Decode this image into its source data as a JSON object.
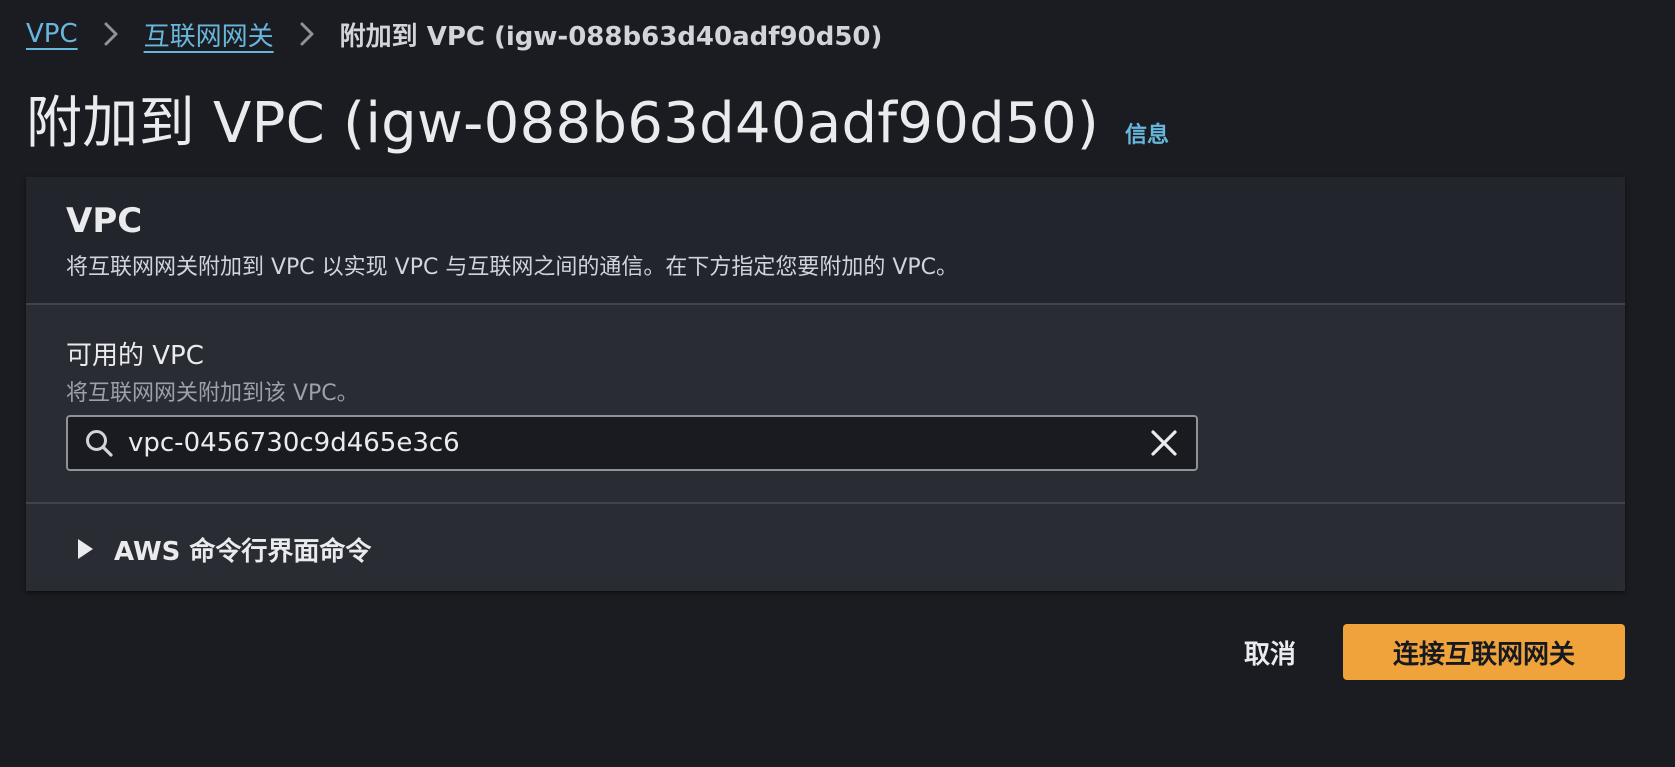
{
  "breadcrumb": {
    "items": [
      {
        "label": "VPC"
      },
      {
        "label": "互联网网关"
      },
      {
        "label": "附加到 VPC (igw-088b63d40adf90d50)"
      }
    ]
  },
  "header": {
    "title": "附加到 VPC (igw-088b63d40adf90d50)",
    "info_link": "信息"
  },
  "section": {
    "title": "VPC",
    "description": "将互联网网关附加到 VPC 以实现 VPC 与互联网之间的通信。在下方指定您要附加的 VPC。"
  },
  "field": {
    "label": "可用的 VPC",
    "description": "将互联网网关附加到该 VPC。",
    "value": "vpc-0456730c9d465e3c6"
  },
  "expander": {
    "label": "AWS 命令行界面命令"
  },
  "actions": {
    "cancel_label": "取消",
    "submit_label": "连接互联网网关"
  },
  "icons": {
    "separator": "chevron-right-icon",
    "search": "search-icon",
    "clear": "close-icon",
    "expander": "caret-right-icon"
  },
  "colors": {
    "background": "#1b1c21",
    "link": "#67b7dc",
    "primary": "#f0a33a"
  }
}
